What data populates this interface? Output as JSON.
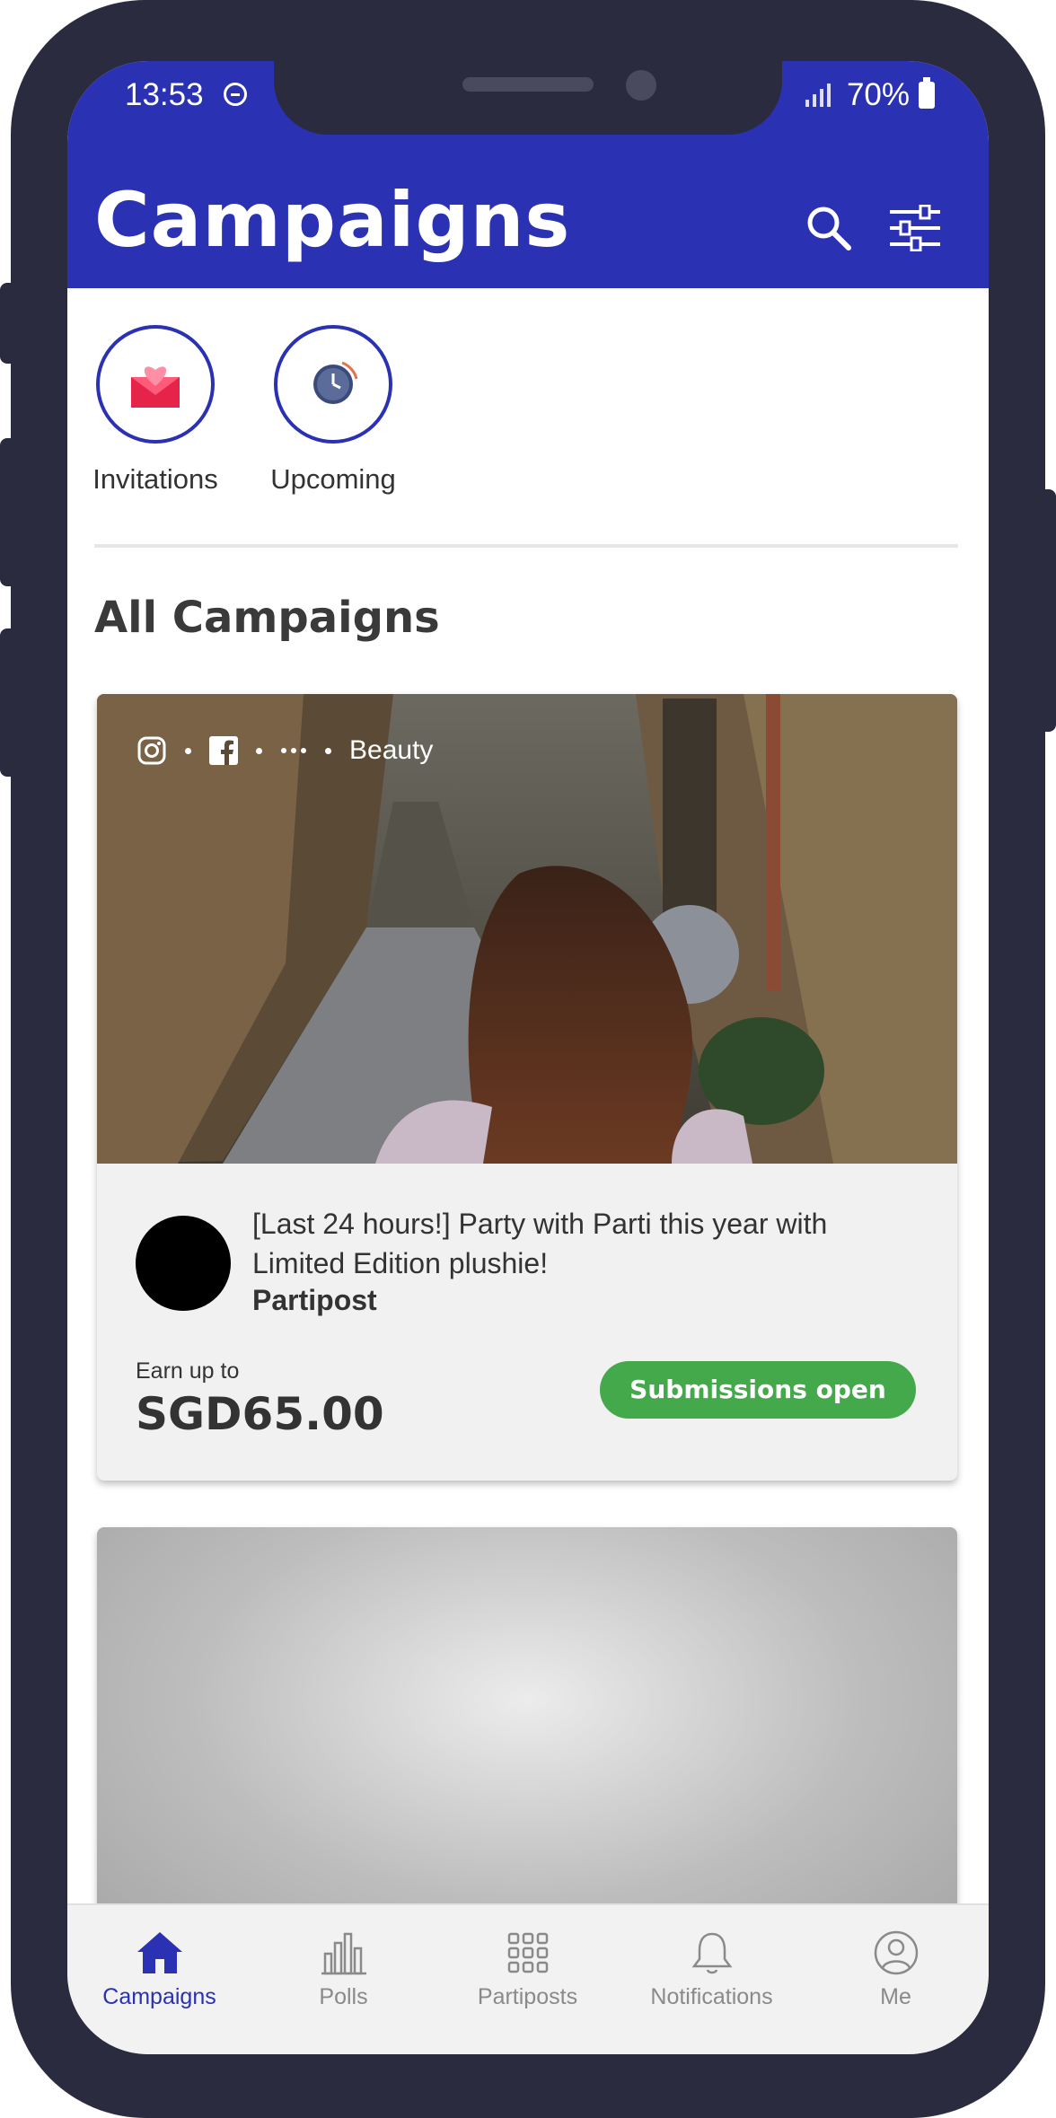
{
  "status_bar": {
    "time": "13:53",
    "battery": "70%"
  },
  "header": {
    "title": "Campaigns"
  },
  "shortcuts": [
    {
      "label": "Invitations",
      "icon": "envelope-heart-icon"
    },
    {
      "label": "Upcoming",
      "icon": "clock-icon"
    }
  ],
  "section_title": "All Campaigns",
  "campaigns": [
    {
      "tags": [
        "instagram-icon",
        "facebook-icon",
        "more-icon"
      ],
      "category": "Beauty",
      "title": "[Last 24 hours!] Party with Parti this year with Limited Edition plushie!",
      "brand": "Partipost",
      "earn_label": "Earn up to",
      "earn_amount": "SGD65.00",
      "status": "Submissions open"
    }
  ],
  "tabbar": [
    {
      "label": "Campaigns",
      "icon": "home-icon",
      "active": true
    },
    {
      "label": "Polls",
      "icon": "bar-chart-icon",
      "active": false
    },
    {
      "label": "Partiposts",
      "icon": "grid-icon",
      "active": false
    },
    {
      "label": "Notifications",
      "icon": "bell-icon",
      "active": false
    },
    {
      "label": "Me",
      "icon": "user-icon",
      "active": false
    }
  ],
  "colors": {
    "brand": "#2a31b3",
    "status_open": "#44a94a",
    "frame": "#2b2b40"
  }
}
